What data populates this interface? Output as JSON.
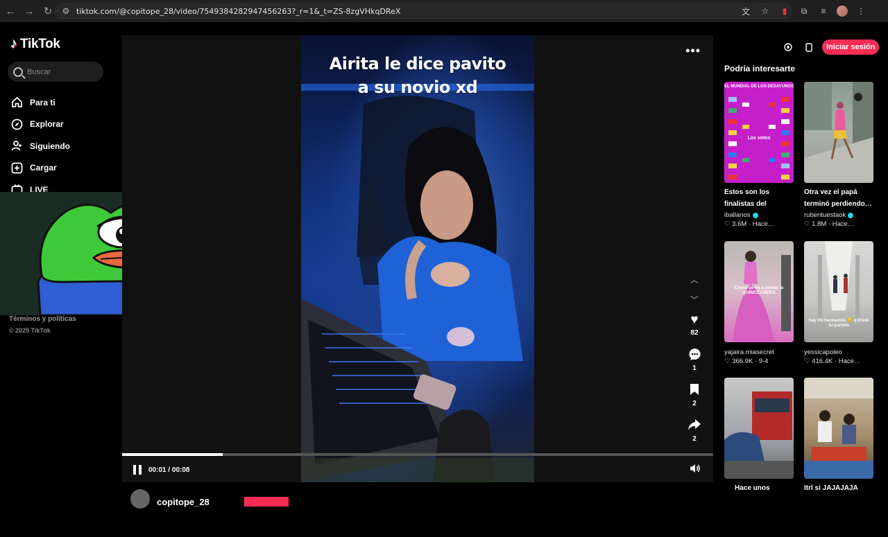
{
  "browser": {
    "url": "tiktok.com/@copitope_28/video/7549384282947456263?_r=1&_t=ZS-8zgVHkqDReX"
  },
  "sidebar": {
    "logo": "TikTok",
    "search_placeholder": "Buscar",
    "items": [
      {
        "label": "Para ti",
        "icon": "home-icon"
      },
      {
        "label": "Explorar",
        "icon": "compass-icon"
      },
      {
        "label": "Siguiendo",
        "icon": "following-icon"
      },
      {
        "label": "Cargar",
        "icon": "upload-icon"
      },
      {
        "label": "LIVE",
        "icon": "live-icon"
      }
    ],
    "footer_terms": "Términos y políticas",
    "footer_copyright": "© 2025 TikTok"
  },
  "video": {
    "caption_line1": "Airita le dice pavito",
    "caption_line2": "a su novio xd",
    "time": "00:01 / 00:08",
    "progress_fraction": 0.17,
    "likes": "82",
    "comments": "1",
    "saves": "2",
    "shares": "2",
    "author": "copitope_28"
  },
  "right": {
    "login_label": "Iniciar sesión",
    "recommend_title": "Podría interesarte",
    "cards": [
      {
        "title": "Estos son los finalistas del mundi…",
        "user": "iballanos",
        "verified": true,
        "stats": "♡ 3.6M · Hace…",
        "thumb_text": "EL MUNDIAL DE LOS DESAYUNOS",
        "thumb_sub": "Los votos"
      },
      {
        "title": "Otra vez el papá terminó perdiendo…",
        "user": "rubentuestaok",
        "verified": true,
        "stats": "♡ 1.8M · Hace…",
        "thumb_text": "",
        "thumb_sub": ""
      },
      {
        "title": "",
        "user": "yajaira.miasecret",
        "verified": false,
        "stats": "♡ 366.9K · 9-4",
        "thumb_text": "Cómo se va a sentar la QUINCEAÑERA",
        "thumb_sub": ""
      },
      {
        "title": "",
        "user": "yessicapoleo",
        "verified": false,
        "stats": "♡ 416.4K · Hace…",
        "thumb_text": "hay mi hermanita 😔 q triste tu partida",
        "thumb_sub": ""
      },
      {
        "title": "Hace unos",
        "user": "",
        "verified": false,
        "stats": "",
        "thumb_text": "",
        "thumb_sub": ""
      },
      {
        "title": "Itrl si JAJAJAJA",
        "user": "",
        "verified": false,
        "stats": "",
        "thumb_text": "",
        "thumb_sub": ""
      }
    ]
  },
  "colors": {
    "accent": "#fe2c55",
    "background": "#000000",
    "player_bg": "#111111"
  }
}
